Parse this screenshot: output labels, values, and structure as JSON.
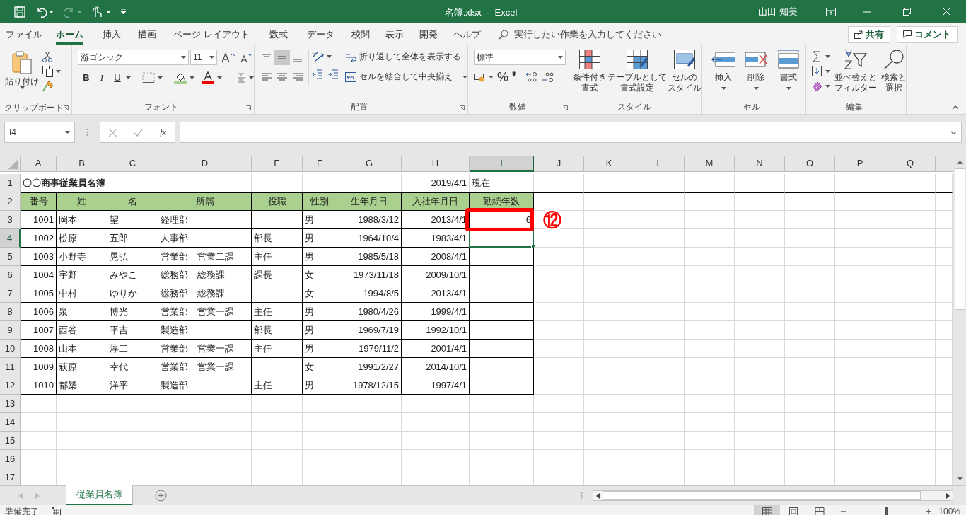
{
  "window": {
    "title": "名簿.xlsx  -  Excel",
    "user": "山田 知美"
  },
  "menu_tabs": [
    {
      "label": "ファイル",
      "selected": false
    },
    {
      "label": "ホーム",
      "selected": true
    },
    {
      "label": "挿入",
      "selected": false
    },
    {
      "label": "描画",
      "selected": false
    },
    {
      "label": "ページ レイアウト",
      "selected": false
    },
    {
      "label": "数式",
      "selected": false
    },
    {
      "label": "データ",
      "selected": false
    },
    {
      "label": "校閲",
      "selected": false
    },
    {
      "label": "表示",
      "selected": false
    },
    {
      "label": "開発",
      "selected": false
    },
    {
      "label": "ヘルプ",
      "selected": false
    }
  ],
  "tell_me": {
    "placeholder": "実行したい作業を入力してください"
  },
  "share_button": "共有",
  "comment_button": "コメント",
  "ribbon": {
    "clipboard": {
      "paste": "貼り付け",
      "label": "クリップボード"
    },
    "font": {
      "font_name": "游ゴシック",
      "font_size": "11",
      "bold": "B",
      "italic": "I",
      "underline": "U",
      "label": "フォント"
    },
    "alignment": {
      "wrap_text": "折り返して全体を表示する",
      "merge_center": "セルを結合して中央揃え",
      "label": "配置"
    },
    "number": {
      "format": "標準",
      "percent": "%",
      "comma": "❜",
      "label": "数値"
    },
    "styles": {
      "buttons": [
        [
          "条件付き",
          "書式"
        ],
        [
          "テーブルとして",
          "書式設定"
        ],
        [
          "セルの",
          "スタイル"
        ]
      ],
      "label": "スタイル"
    },
    "cells": {
      "buttons": [
        "挿入",
        "削除",
        "書式"
      ],
      "label": "セル"
    },
    "editing": {
      "sort_filter": [
        "並べ替えと",
        "フィルター"
      ],
      "find_select": [
        "検索と",
        "選択"
      ],
      "label": "編集"
    }
  },
  "formula_bar": {
    "name_box": "I4",
    "fx": "fx"
  },
  "columns": [
    {
      "label": "A",
      "selected": false
    },
    {
      "label": "B",
      "selected": false
    },
    {
      "label": "C",
      "selected": false
    },
    {
      "label": "D",
      "selected": false
    },
    {
      "label": "E",
      "selected": false
    },
    {
      "label": "F",
      "selected": false
    },
    {
      "label": "G",
      "selected": false
    },
    {
      "label": "H",
      "selected": false
    },
    {
      "label": "I",
      "selected": true
    },
    {
      "label": "J",
      "selected": false
    },
    {
      "label": "K",
      "selected": false
    },
    {
      "label": "L",
      "selected": false
    },
    {
      "label": "M",
      "selected": false
    },
    {
      "label": "N",
      "selected": false
    },
    {
      "label": "O",
      "selected": false
    },
    {
      "label": "P",
      "selected": false
    },
    {
      "label": "Q",
      "selected": false
    }
  ],
  "rows": [
    {
      "number": "1",
      "selected": false,
      "kind": "title",
      "cells": [
        "〇〇商事従業員名簿",
        null,
        null,
        null,
        null,
        null,
        null,
        "2019/4/1",
        "現在"
      ]
    },
    {
      "number": "2",
      "selected": false,
      "kind": "header",
      "cells": [
        "番号",
        "姓",
        "名",
        "所属",
        "役職",
        "性別",
        "生年月日",
        "入社年月日",
        "勤続年数"
      ]
    },
    {
      "number": "3",
      "selected": false,
      "kind": "data",
      "cells": [
        "1001",
        "岡本",
        "望",
        "経理部",
        null,
        "男",
        "1988/3/12",
        "2013/4/1",
        {
          "text": "6",
          "callout": "⑫"
        }
      ]
    },
    {
      "number": "4",
      "selected": true,
      "kind": "data",
      "cells": [
        "1002",
        "松原",
        "五郎",
        "人事部",
        "部長",
        "男",
        "1964/10/4",
        "1983/4/1",
        {
          "selected": true
        }
      ]
    },
    {
      "number": "5",
      "selected": false,
      "kind": "data",
      "cells": [
        "1003",
        "小野寺",
        "晃弘",
        "営業部　営業二課",
        "主任",
        "男",
        "1985/5/18",
        "2008/4/1",
        null
      ]
    },
    {
      "number": "6",
      "selected": false,
      "kind": "data",
      "cells": [
        "1004",
        "宇野",
        "みやこ",
        "総務部　総務課",
        "課長",
        "女",
        "1973/11/18",
        "2009/10/1",
        null
      ]
    },
    {
      "number": "7",
      "selected": false,
      "kind": "data",
      "cells": [
        "1005",
        "中村",
        "ゆりか",
        "総務部　総務課",
        null,
        "女",
        "1994/8/5",
        "2013/4/1",
        null
      ]
    },
    {
      "number": "8",
      "selected": false,
      "kind": "data",
      "cells": [
        "1006",
        "泉",
        "博光",
        "営業部　営業一課",
        "主任",
        "男",
        "1980/4/26",
        "1999/4/1",
        null
      ]
    },
    {
      "number": "9",
      "selected": false,
      "kind": "data",
      "cells": [
        "1007",
        "西谷",
        "平吉",
        "製造部",
        "部長",
        "男",
        "1969/7/19",
        "1992/10/1",
        null
      ]
    },
    {
      "number": "10",
      "selected": false,
      "kind": "data",
      "cells": [
        "1008",
        "山本",
        "淳二",
        "営業部　営業一課",
        "主任",
        "男",
        "1979/11/2",
        "2001/4/1",
        null
      ]
    },
    {
      "number": "11",
      "selected": false,
      "kind": "data",
      "cells": [
        "1009",
        "萩原",
        "幸代",
        "営業部　営業一課",
        null,
        "女",
        "1991/2/27",
        "2014/10/1",
        null
      ]
    },
    {
      "number": "12",
      "selected": false,
      "kind": "data",
      "cells": [
        "1010",
        "都築",
        "洋平",
        "製造部",
        "主任",
        "男",
        "1978/12/15",
        "1997/4/1",
        null
      ]
    },
    {
      "number": "13",
      "selected": false,
      "kind": "empty"
    },
    {
      "number": "14",
      "selected": false,
      "kind": "empty"
    },
    {
      "number": "15",
      "selected": false,
      "kind": "empty"
    },
    {
      "number": "16",
      "selected": false,
      "kind": "empty"
    },
    {
      "number": "17",
      "selected": false,
      "kind": "empty"
    }
  ],
  "sheet_tabs": [
    {
      "label": "従業員名簿",
      "selected": true
    }
  ],
  "status_bar": {
    "status": "準備完了",
    "views": [
      {
        "selected": true
      },
      {
        "selected": false
      },
      {
        "selected": false
      }
    ],
    "zoom_level": {
      "level": 0.5
    },
    "zoom": "100%"
  }
}
